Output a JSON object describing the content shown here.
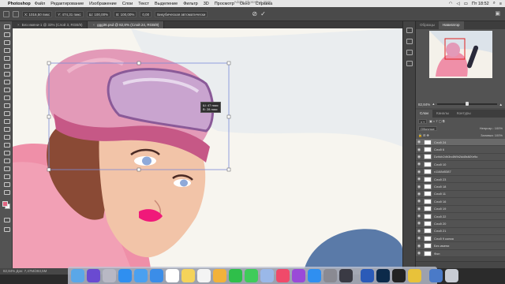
{
  "menubar": {
    "app_name": "Photoshop",
    "items": [
      "Файл",
      "Редактирование",
      "Изображение",
      "Слои",
      "Текст",
      "Выделение",
      "Фильтр",
      "3D",
      "Просмотр",
      "Окно",
      "Справка"
    ],
    "time": "Пт 18:52"
  },
  "window": {
    "title": "Adobe Photoshop 2020"
  },
  "options": {
    "x_value": "X: 1016,50 пикс",
    "y_value": "Y: 474,31 пикс",
    "w_value": "Ш: 100,00%",
    "h_value": "В: 100,00%",
    "angle_value": "0,00",
    "interp_value": "Бикубическая автоматически",
    "commit_icon": "check-icon",
    "cancel_icon": "cancel-icon"
  },
  "tabs": [
    {
      "label": "Без имени-1 @ 33% (Слой 3, RGB/8)"
    },
    {
      "label": "ggg36.psd @ 82,8% (Слой 24, RGB/8)"
    }
  ],
  "canvas": {
    "tooltip_line1": "Ш: 47 пикс",
    "tooltip_line2": "В: 28 пикс",
    "colors": {
      "skin": "#f2c4a8",
      "hat": "#e39ab8",
      "hat_band": "#c65886",
      "goggles": "#c9a4cf",
      "hair": "#8a4a35",
      "coat": "#ef8fa8",
      "bg": "#f7f5ef",
      "lips": "#f0197a",
      "eyes": "#8ea9d9"
    }
  },
  "status": {
    "text": "82,84%    Док: 7,47М/283,5М"
  },
  "panels": {
    "top_tabs": [
      "Образцы",
      "Навигатор"
    ],
    "zoom_value": "82,84%",
    "layer_tabs": [
      "Слои",
      "Каналы",
      "Контуры"
    ],
    "filter_label": "Обычные",
    "opacity_label": "Непрозр.: 100%",
    "fill_label": "Заливка: 100%",
    "layers": [
      {
        "name": "Слой 24",
        "selected": true
      },
      {
        "name": "Слой 6"
      },
      {
        "name": "Dzhkh2dh3ndWth2dd8sMXe9o"
      },
      {
        "name": "Слой 10"
      },
      {
        "name": "x1168d5387"
      },
      {
        "name": "Слой 23"
      },
      {
        "name": "Слой 18"
      },
      {
        "name": "Слой 11"
      },
      {
        "name": "Слой 16"
      },
      {
        "name": "Слой 19"
      },
      {
        "name": "Слой 22"
      },
      {
        "name": "Слой 20"
      },
      {
        "name": "Слой 21"
      },
      {
        "name": "Слой 9 копия"
      },
      {
        "name": "Без имени"
      },
      {
        "name": "Фон"
      }
    ]
  },
  "dock": {
    "apps": [
      {
        "icon": "finder-icon",
        "color": "#5aa7e8"
      },
      {
        "icon": "siri-icon",
        "color": "#6a4ad1"
      },
      {
        "icon": "launchpad-icon",
        "color": "#b8b8c4"
      },
      {
        "icon": "safari-icon",
        "color": "#2f8ff0"
      },
      {
        "icon": "photos-icon",
        "color": "#4aa0f0"
      },
      {
        "icon": "mail-icon",
        "color": "#3b8de8"
      },
      {
        "icon": "calendar-icon",
        "color": "#ffffff"
      },
      {
        "icon": "notes-icon",
        "color": "#f5d35a"
      },
      {
        "icon": "reminders-icon",
        "color": "#f4f4f4"
      },
      {
        "icon": "photos-flower-icon",
        "color": "#f2b23a"
      },
      {
        "icon": "facetime-icon",
        "color": "#2fbf4a"
      },
      {
        "icon": "messages-icon",
        "color": "#3fcc5a"
      },
      {
        "icon": "preview-icon",
        "color": "#9ab8e8"
      },
      {
        "icon": "music-icon",
        "color": "#f04a6a"
      },
      {
        "icon": "podcasts-icon",
        "color": "#9a4ad8"
      },
      {
        "icon": "appstore-icon",
        "color": "#2f8ff0"
      },
      {
        "icon": "settings-icon",
        "color": "#8a8a92"
      },
      {
        "icon": "quicktime-icon",
        "color": "#3a3a44"
      },
      {
        "icon": "word-icon",
        "color": "#2b5bb8"
      },
      {
        "icon": "photoshop-icon",
        "color": "#0c2a4a"
      },
      {
        "icon": "terminal-icon",
        "color": "#222222"
      },
      {
        "icon": "chrome-icon",
        "color": "#e8c23a"
      },
      {
        "icon": "downloads-icon",
        "color": "#4a7ac8"
      },
      {
        "icon": "trash-icon",
        "color": "#c8ccd4"
      }
    ]
  }
}
